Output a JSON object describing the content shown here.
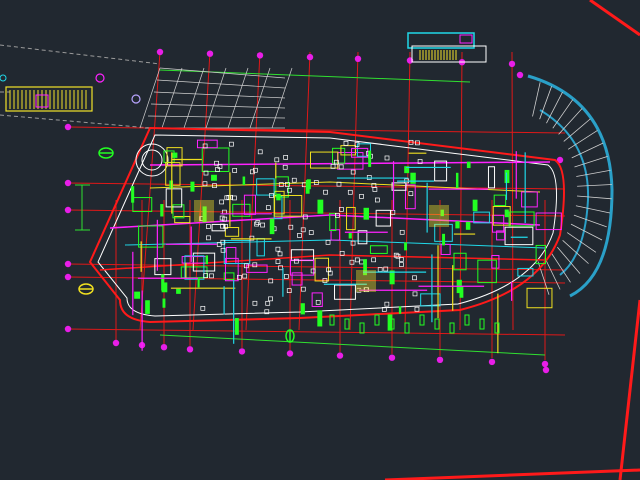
{
  "drawing": {
    "kind": "cad-floor-plan",
    "colors": {
      "background": "#212830",
      "grid_line": "#e01818",
      "grid_bubble": "#e81ee8",
      "wall": "#ffffff",
      "boundary": "#ff1a1a",
      "dimension": "#30e030",
      "pipe_magenta": "#ff22ff",
      "pipe_yellow": "#f0e020",
      "duct_cyan": "#20d8e8",
      "equipment_green": "#22ff22",
      "stair_cyan": "#2aa0c8",
      "hatch_yellow": "#f2e22a",
      "dashed_line": "#9a9a9a"
    }
  }
}
